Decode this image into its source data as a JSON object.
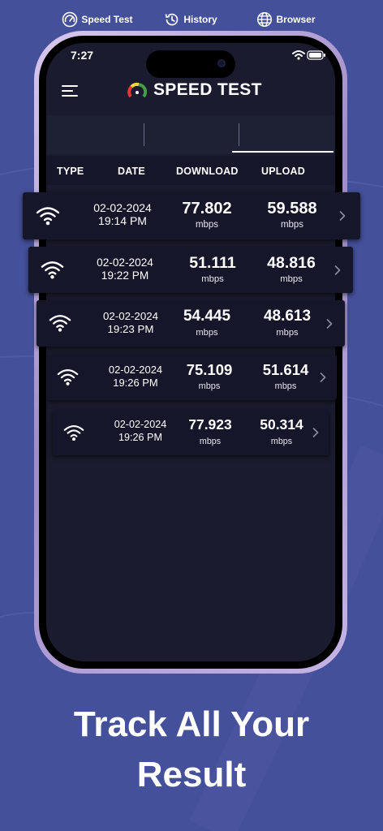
{
  "status": {
    "time": "7:27"
  },
  "app": {
    "title": "SPEED TEST"
  },
  "tabs": [
    {
      "label": "Speed Test",
      "active": false
    },
    {
      "label": "History",
      "active": false
    },
    {
      "label": "Browser",
      "active": true
    }
  ],
  "columns": {
    "type": "TYPE",
    "date": "DATE",
    "download": "DOWNLOAD",
    "upload": "UPLOAD"
  },
  "rows": [
    {
      "date": "02-02-2024",
      "time": "19:14 PM",
      "download": "77.802",
      "download_unit": "mbps",
      "upload": "59.588",
      "upload_unit": "mbps"
    },
    {
      "date": "02-02-2024",
      "time": "19:22 PM",
      "download": "51.111",
      "download_unit": "mbps",
      "upload": "48.816",
      "upload_unit": "mbps"
    },
    {
      "date": "02-02-2024",
      "time": "19:23 PM",
      "download": "54.445",
      "download_unit": "mbps",
      "upload": "48.613",
      "upload_unit": "mbps"
    },
    {
      "date": "02-02-2024",
      "time": "19:26 PM",
      "download": "75.109",
      "download_unit": "mbps",
      "upload": "51.614",
      "upload_unit": "mbps"
    },
    {
      "date": "02-02-2024",
      "time": "19:26 PM",
      "download": "77.923",
      "download_unit": "mbps",
      "upload": "50.314",
      "upload_unit": "mbps"
    }
  ],
  "promo": {
    "line1": "Track All Your",
    "line2": "Result"
  },
  "colors": {
    "background": "#45509a",
    "screen": "#1a1b2e",
    "row": "#15162a"
  }
}
